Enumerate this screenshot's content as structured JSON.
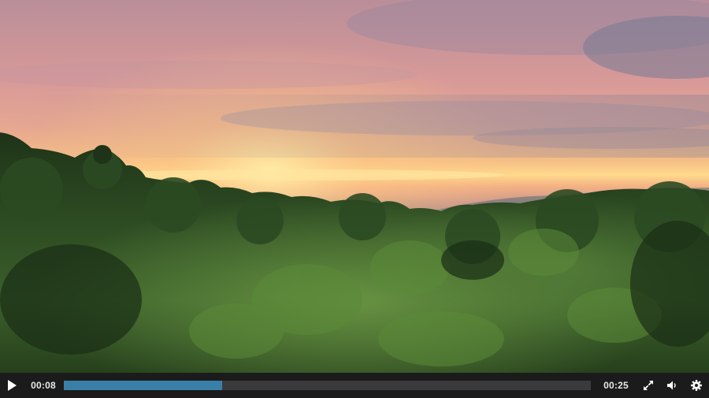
{
  "player": {
    "current_time": "00:08",
    "duration": "00:25",
    "progress_fraction": 0.3,
    "accent_color": "#3a7fa8",
    "controls": {
      "play_icon": "play-icon",
      "fullscreen_icon": "fullscreen-icon",
      "volume_icon": "volume-icon",
      "settings_icon": "gear-icon"
    }
  },
  "video": {
    "scene_colors": {
      "sky_top": "#c99aa0",
      "sky_glow": "#ffc77a",
      "forest_dark": "#1d3a1a",
      "forest_light": "#4f7a33"
    }
  }
}
